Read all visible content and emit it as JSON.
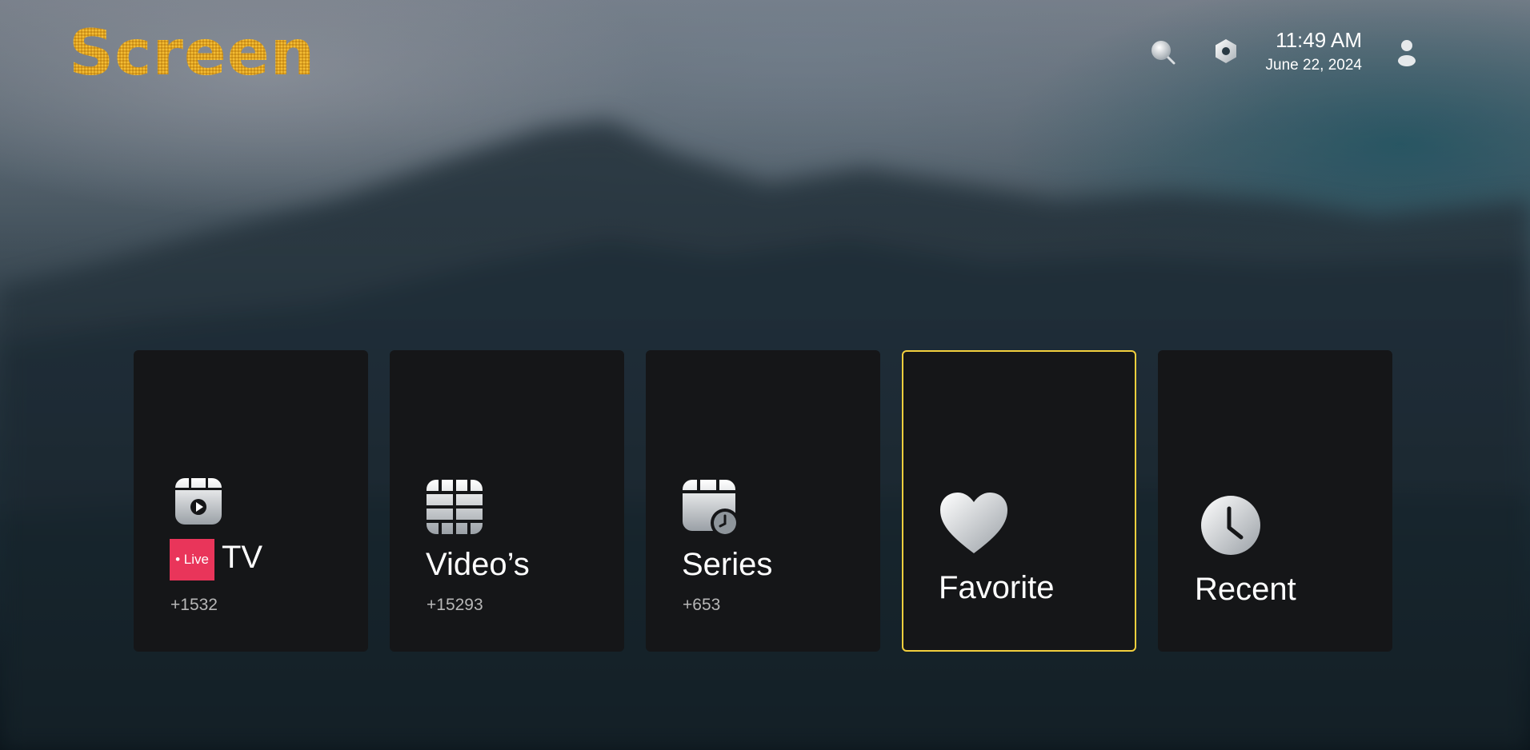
{
  "app": {
    "logo_text": "Screen"
  },
  "header": {
    "time": "11:49 AM",
    "date": "June 22, 2024",
    "icons": [
      "search-icon",
      "settings-icon",
      "profile-icon"
    ]
  },
  "cards": [
    {
      "id": "tv",
      "badge": "• Live",
      "title": "TV",
      "count": "+1532",
      "icon": "live-tv-icon",
      "selected": false
    },
    {
      "id": "videos",
      "title": "Video’s",
      "count": "+15293",
      "icon": "film-grid-icon",
      "selected": false
    },
    {
      "id": "series",
      "title": "Series",
      "count": "+653",
      "icon": "series-clock-icon",
      "selected": false
    },
    {
      "id": "favorite",
      "title": "Favorite",
      "icon": "heart-icon",
      "selected": true
    },
    {
      "id": "recent",
      "title": "Recent",
      "icon": "clock-icon",
      "selected": false
    }
  ],
  "colors": {
    "accent": "#f2cf3d",
    "logo": "#e9a822",
    "live_badge": "#e9355a",
    "card_bg": "#151618"
  }
}
